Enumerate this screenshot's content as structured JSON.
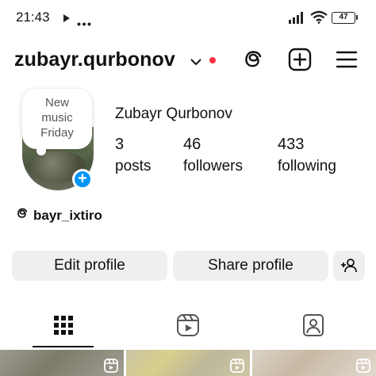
{
  "status_bar": {
    "time": "21:43",
    "battery": "47",
    "icons": [
      "play-icon",
      "more-dots-icon",
      "signal-icon",
      "wifi-icon",
      "battery-icon"
    ]
  },
  "header": {
    "username": "zubayr.qurbonov",
    "icons": [
      "chevron-down-icon",
      "notification-dot",
      "threads-icon",
      "create-icon",
      "menu-icon"
    ],
    "accent_color": "#ff3040"
  },
  "profile": {
    "note_lines": [
      "New",
      "music",
      "Friday"
    ],
    "display_name": "Zubayr Qurbonov",
    "stats": [
      {
        "value": "3",
        "label": "posts"
      },
      {
        "value": "46",
        "label": "followers"
      },
      {
        "value": "433",
        "label": "following"
      }
    ],
    "badge_color": "#0095f6"
  },
  "threads_link": {
    "icon": "threads-icon",
    "handle": "bayr_ixtiro"
  },
  "actions": {
    "edit_profile": "Edit profile",
    "share_profile": "Share profile",
    "discover_icon": "add-person-icon"
  },
  "tabs": [
    {
      "name": "grid-icon",
      "active": true
    },
    {
      "name": "reels-icon",
      "active": false
    },
    {
      "name": "tagged-icon",
      "active": false
    }
  ],
  "grid": {
    "items": [
      {
        "type": "reel",
        "icon": "reel-icon"
      },
      {
        "type": "reel",
        "icon": "reel-icon"
      },
      {
        "type": "reel",
        "icon": "reel-icon"
      }
    ]
  }
}
